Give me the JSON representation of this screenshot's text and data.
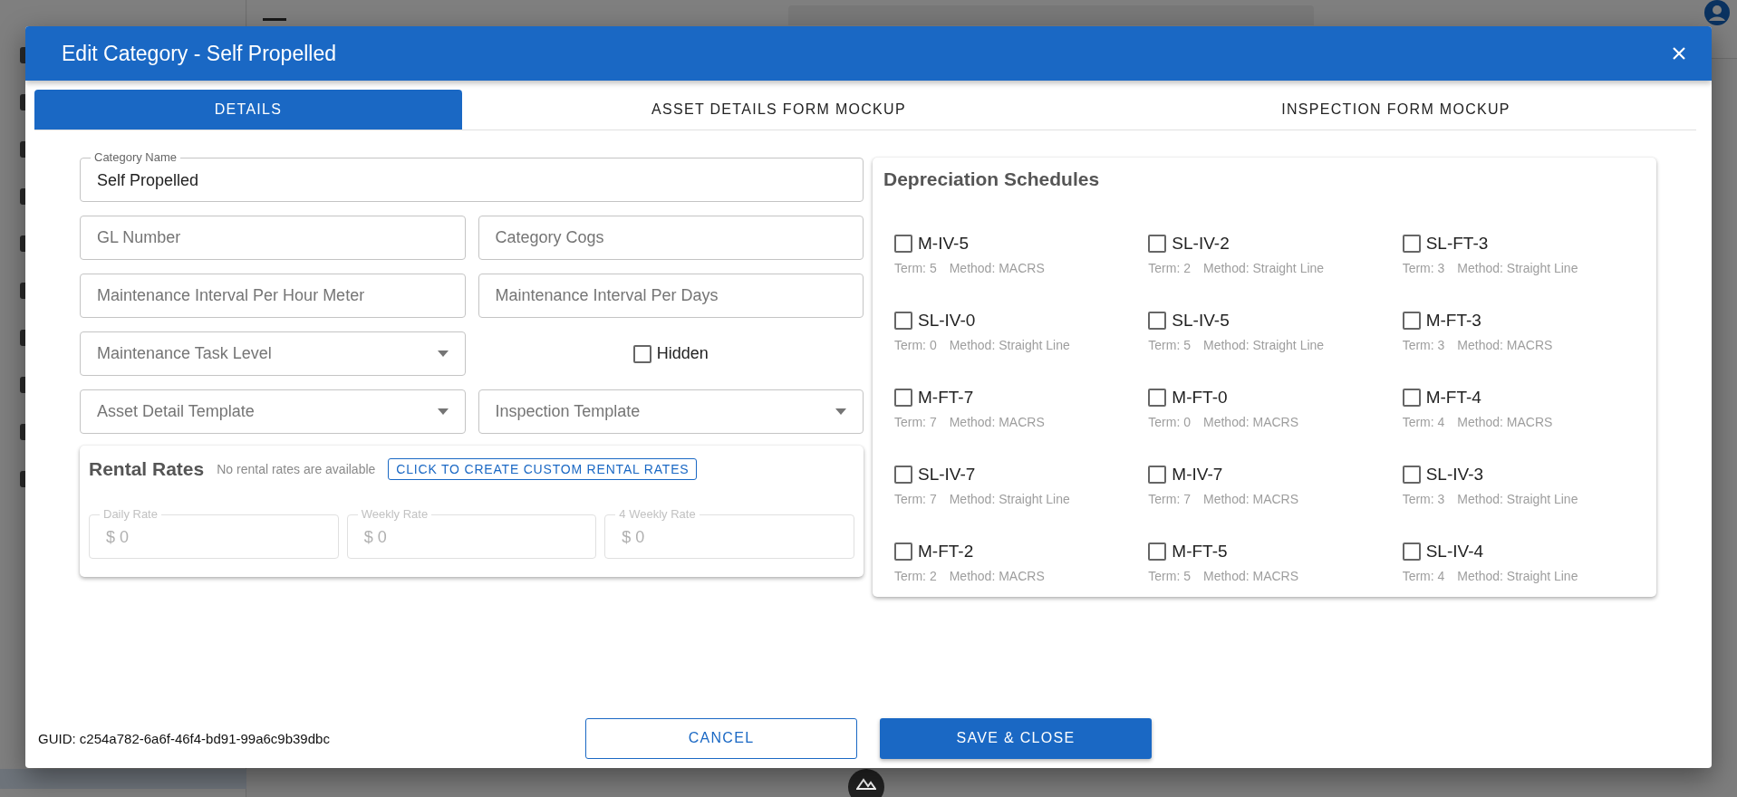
{
  "dialog": {
    "title": "Edit Category - Self Propelled"
  },
  "tabs": [
    {
      "label": "DETAILS",
      "selected": true
    },
    {
      "label": "ASSET DETAILS FORM MOCKUP",
      "selected": false
    },
    {
      "label": "INSPECTION FORM MOCKUP",
      "selected": false
    }
  ],
  "form_rows": [
    [
      {
        "kind": "text",
        "label": "Category Name",
        "value": "Self Propelled"
      }
    ],
    [
      {
        "kind": "text",
        "placeholder": "GL Number"
      },
      {
        "kind": "text",
        "placeholder": "Category Cogs"
      }
    ],
    [
      {
        "kind": "text",
        "placeholder": "Maintenance Interval Per Hour Meter"
      },
      {
        "kind": "text",
        "placeholder": "Maintenance Interval Per Days"
      }
    ],
    [
      {
        "kind": "select",
        "placeholder": "Maintenance Task Level"
      },
      {
        "kind": "checkbox",
        "label": "Hidden",
        "checked": false
      }
    ],
    [
      {
        "kind": "select",
        "placeholder": "Asset Detail Template"
      },
      {
        "kind": "select",
        "placeholder": "Inspection Template"
      }
    ]
  ],
  "rental_rates": {
    "title": "Rental Rates",
    "note": "No rental rates are available",
    "button": "CLICK TO CREATE CUSTOM RENTAL RATES",
    "fields": [
      {
        "label": "Daily Rate",
        "value": "$ 0",
        "disabled": true
      },
      {
        "label": "Weekly Rate",
        "value": "$ 0",
        "disabled": true
      },
      {
        "label": "4 Weekly Rate",
        "value": "$ 0",
        "disabled": true
      }
    ]
  },
  "depreciation": {
    "title": "Depreciation Schedules",
    "schedules": [
      {
        "name": "M-IV-5",
        "checked": false,
        "term": "Term: 5",
        "method": "Method: MACRS"
      },
      {
        "name": "SL-IV-2",
        "checked": false,
        "term": "Term: 2",
        "method": "Method: Straight Line"
      },
      {
        "name": "SL-FT-3",
        "checked": false,
        "term": "Term: 3",
        "method": "Method: Straight Line"
      },
      {
        "name": "SL-IV-0",
        "checked": false,
        "term": "Term: 0",
        "method": "Method: Straight Line"
      },
      {
        "name": "SL-IV-5",
        "checked": false,
        "term": "Term: 5",
        "method": "Method: Straight Line"
      },
      {
        "name": "M-FT-3",
        "checked": false,
        "term": "Term: 3",
        "method": "Method: MACRS"
      },
      {
        "name": "M-FT-7",
        "checked": false,
        "term": "Term: 7",
        "method": "Method: MACRS"
      },
      {
        "name": "M-FT-0",
        "checked": false,
        "term": "Term: 0",
        "method": "Method: MACRS"
      },
      {
        "name": "M-FT-4",
        "checked": false,
        "term": "Term: 4",
        "method": "Method: MACRS"
      },
      {
        "name": "SL-IV-7",
        "checked": false,
        "term": "Term: 7",
        "method": "Method: Straight Line"
      },
      {
        "name": "M-IV-7",
        "checked": false,
        "term": "Term: 7",
        "method": "Method: MACRS"
      },
      {
        "name": "SL-IV-3",
        "checked": false,
        "term": "Term: 3",
        "method": "Method: Straight Line"
      },
      {
        "name": "M-FT-2",
        "checked": false,
        "term": "Term: 2",
        "method": "Method: MACRS"
      },
      {
        "name": "M-FT-5",
        "checked": false,
        "term": "Term: 5",
        "method": "Method: MACRS"
      },
      {
        "name": "SL-IV-4",
        "checked": false,
        "term": "Term: 4",
        "method": "Method: Straight Line"
      }
    ]
  },
  "footer": {
    "guid": "GUID: c254a782-6a6f-46f4-bd91-99a6c9b39dbc",
    "cancel": "CANCEL",
    "save": "SAVE & CLOSE"
  }
}
